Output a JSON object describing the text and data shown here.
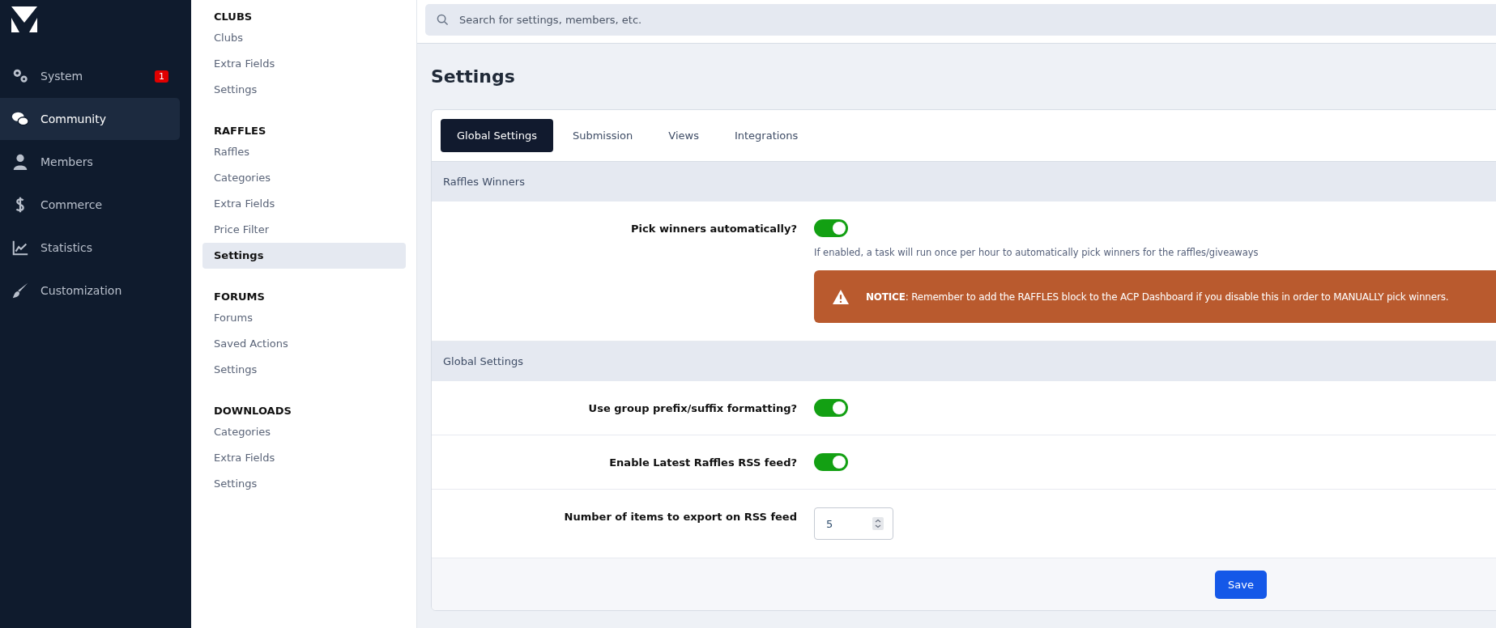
{
  "sidebar": {
    "items": [
      {
        "label": "System",
        "selected": false,
        "badge": "1"
      },
      {
        "label": "Community",
        "selected": true
      },
      {
        "label": "Members",
        "selected": false
      },
      {
        "label": "Commerce",
        "selected": false
      },
      {
        "label": "Statistics",
        "selected": false
      },
      {
        "label": "Customization",
        "selected": false
      }
    ]
  },
  "subnav": {
    "groups": [
      {
        "title": "CLUBS",
        "items": [
          {
            "label": "Clubs",
            "selected": false
          },
          {
            "label": "Extra Fields",
            "selected": false
          },
          {
            "label": "Settings",
            "selected": false
          }
        ]
      },
      {
        "title": "RAFFLES",
        "items": [
          {
            "label": "Raffles",
            "selected": false
          },
          {
            "label": "Categories",
            "selected": false
          },
          {
            "label": "Extra Fields",
            "selected": false
          },
          {
            "label": "Price Filter",
            "selected": false
          },
          {
            "label": "Settings",
            "selected": true
          }
        ]
      },
      {
        "title": "FORUMS",
        "items": [
          {
            "label": "Forums",
            "selected": false
          },
          {
            "label": "Saved Actions",
            "selected": false
          },
          {
            "label": "Settings",
            "selected": false
          }
        ]
      },
      {
        "title": "DOWNLOADS",
        "items": [
          {
            "label": "Categories",
            "selected": false
          },
          {
            "label": "Extra Fields",
            "selected": false
          },
          {
            "label": "Settings",
            "selected": false
          }
        ]
      }
    ]
  },
  "search": {
    "placeholder": "Search for settings, members, etc."
  },
  "page_title": "Settings",
  "tabs": [
    {
      "label": "Global Settings",
      "selected": true
    },
    {
      "label": "Submission",
      "selected": false
    },
    {
      "label": "Views",
      "selected": false
    },
    {
      "label": "Integrations",
      "selected": false
    }
  ],
  "sections": [
    {
      "title": "Raffles Winners",
      "rows": [
        {
          "kind": "toggle",
          "label": "Pick winners automatically?",
          "on": true,
          "help": "If enabled, a task will run once per hour to automatically pick winners for the raffles/giveaways",
          "notice": "**NOTICE**: Remember to add the RAFFLES block to the ACP Dashboard if you disable this in order to MANUALLY pick winners."
        }
      ]
    },
    {
      "title": "Global Settings",
      "rows": [
        {
          "kind": "toggle",
          "label": "Use group prefix/suffix formatting?",
          "on": true
        },
        {
          "kind": "toggle",
          "label": "Enable Latest Raffles RSS feed?",
          "on": true
        },
        {
          "kind": "number",
          "label": "Number of items to export on RSS feed",
          "value": "5"
        }
      ]
    }
  ],
  "save_button": "Save"
}
